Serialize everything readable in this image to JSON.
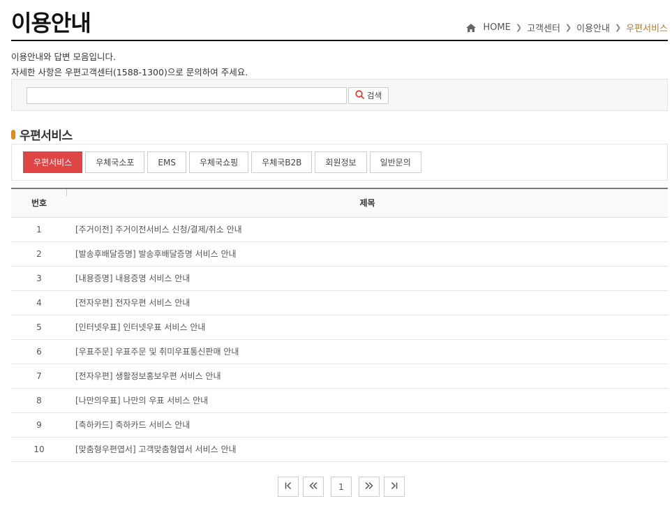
{
  "header": {
    "title": "이용안내",
    "breadcrumb": [
      "HOME",
      "고객센터",
      "이용안내",
      "우편서비스"
    ]
  },
  "intro": {
    "line1": "이용안내와 답변 모음입니다.",
    "line2": "자세한 사항은 우편고객센터(1588-1300)으로 문의하여 주세요."
  },
  "search": {
    "value": "",
    "placeholder": "",
    "button_label": "검색"
  },
  "section": {
    "title": "우편서비스"
  },
  "tabs": [
    "우편서비스",
    "우체국소포",
    "EMS",
    "우체국쇼핑",
    "우체국B2B",
    "회원정보",
    "일반문의"
  ],
  "table": {
    "headers": {
      "no": "번호",
      "subject": "제목"
    },
    "rows": [
      {
        "no": "1",
        "subject": "[주거이전] 주거이전서비스 신청/결제/취소 안내"
      },
      {
        "no": "2",
        "subject": "[발송후배달증명] 발송후배달증명 서비스 안내"
      },
      {
        "no": "3",
        "subject": "[내용증명] 내용증명 서비스 안내"
      },
      {
        "no": "4",
        "subject": "[전자우편] 전자우편 서비스 안내"
      },
      {
        "no": "5",
        "subject": "[인터넷우표] 인터넷우표 서비스 안내"
      },
      {
        "no": "6",
        "subject": "[우표주문] 우표주문 및 취미우표통신판매 안내"
      },
      {
        "no": "7",
        "subject": "[전자우편] 생활정보홍보우편 서비스 안내"
      },
      {
        "no": "8",
        "subject": "[나만의우표] 나만의 우표 서비스 안내"
      },
      {
        "no": "9",
        "subject": "[축하카드] 축하카드 서비스 안내"
      },
      {
        "no": "10",
        "subject": "[맞춤형우편엽서] 고객맞춤형엽서 서비스 안내"
      }
    ]
  },
  "pagination": {
    "current_page": "1",
    "icons": [
      "first-page-icon",
      "prev-page-icon",
      "next-page-icon",
      "last-page-icon"
    ]
  },
  "colors": {
    "accent_red": "#e04545",
    "breadcrumb_current": "#b07a3a",
    "section_bullet": "#e08a1e"
  }
}
